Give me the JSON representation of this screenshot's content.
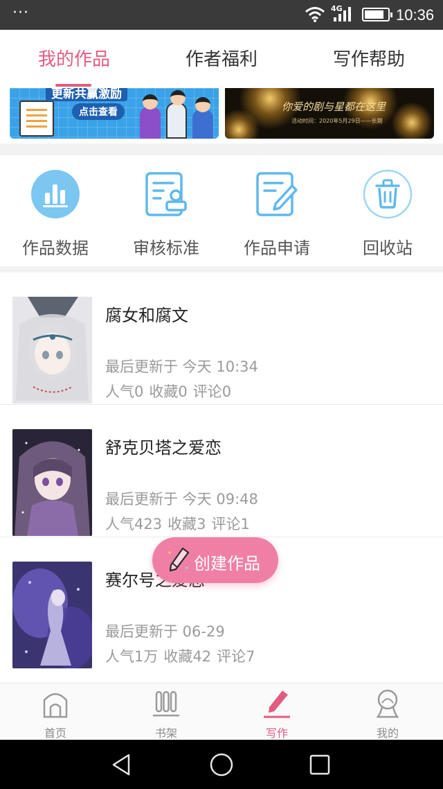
{
  "status_bar": {
    "dots": "···",
    "network": "4G",
    "battery_level": 0.85,
    "time": "10:36"
  },
  "top_tabs": [
    {
      "label": "我的作品",
      "active": true
    },
    {
      "label": "作者福利",
      "active": false
    },
    {
      "label": "写作帮助",
      "active": false
    }
  ],
  "banners": {
    "left": {
      "headline": "更新共赢激励",
      "cta": "点击查看"
    },
    "right": {
      "title": "你爱的剧与星都在这里",
      "subtitle": "活动时间：2020年5月29日——长期"
    }
  },
  "quick_actions": [
    {
      "label": "作品数据",
      "icon": "bar-chart-icon"
    },
    {
      "label": "审核标准",
      "icon": "review-stamp-icon"
    },
    {
      "label": "作品申请",
      "icon": "edit-document-icon"
    },
    {
      "label": "回收站",
      "icon": "trash-icon"
    }
  ],
  "works": [
    {
      "title": "腐女和腐文",
      "updated": "最后更新于 今天 10:34",
      "popularity": "人气0",
      "favorites": "收藏0",
      "comments": "评论0"
    },
    {
      "title": "舒克贝塔之爱恋",
      "updated": "最后更新于 今天 09:48",
      "popularity": "人气423",
      "favorites": "收藏3",
      "comments": "评论1"
    },
    {
      "title": "赛尔号之爱恋",
      "updated": "最后更新于 06-29",
      "popularity": "人气1万",
      "favorites": "收藏42",
      "comments": "评论7"
    }
  ],
  "fab": {
    "label": "创建作品",
    "icon": "pencil-icon"
  },
  "bottom_nav": [
    {
      "label": "首页",
      "icon": "home-arch-icon",
      "active": false
    },
    {
      "label": "书架",
      "icon": "bookshelf-icon",
      "active": false
    },
    {
      "label": "写作",
      "icon": "pencil-icon",
      "active": true
    },
    {
      "label": "我的",
      "icon": "profile-icon",
      "active": false
    }
  ],
  "colors": {
    "accent": "#e25c7f",
    "fab": "#f07fa5",
    "icon_blue": "#5fb8ee",
    "muted_text": "#9a9a9a"
  }
}
